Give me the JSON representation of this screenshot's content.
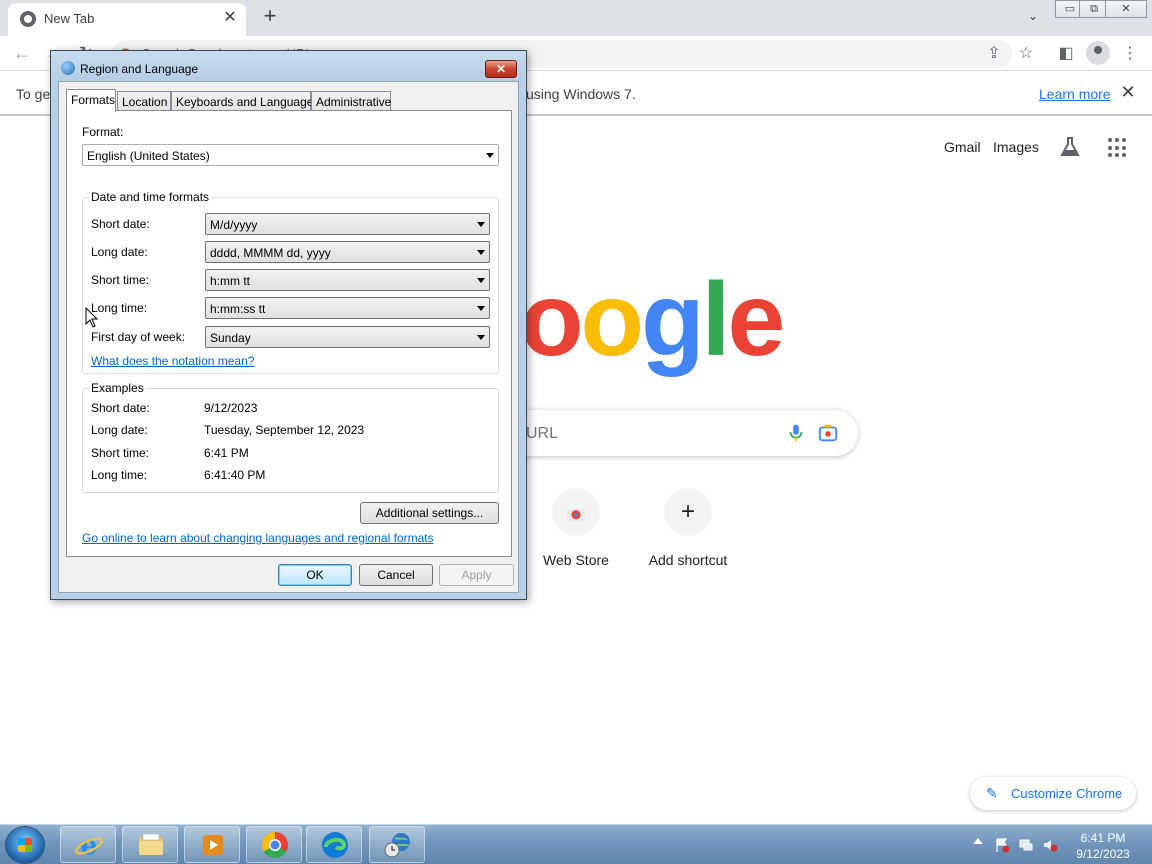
{
  "browser": {
    "tab_title": "New Tab",
    "omnibox_placeholder": "Search Google or type a URL",
    "infobar": {
      "message_start": "To get future Google Chrome updates, you'll need Windows 10 or later. This computer is using Windows 7.",
      "message_visible_left": "To get",
      "message_visible_right": "using Windows 7.",
      "learn_more": "Learn more"
    },
    "header_links": [
      "Gmail",
      "Images"
    ],
    "logo_letters": [
      "o",
      "o",
      "g",
      "l",
      "e"
    ],
    "logo_colors": [
      "#ea4335",
      "#fbbc05",
      "#4285f4",
      "#34a853",
      "#ea4335"
    ],
    "search_placeholder": "URL",
    "shortcuts": [
      {
        "label": "Web Store",
        "icon": "chrome-web-store-icon"
      },
      {
        "label": "Add shortcut",
        "icon": "plus-icon",
        "glyph": "+"
      }
    ],
    "customize_label": "Customize Chrome"
  },
  "dialog": {
    "title": "Region and Language",
    "tabs": [
      "Formats",
      "Location",
      "Keyboards and Languages",
      "Administrative"
    ],
    "active_tab": "Formats",
    "format_label": "Format:",
    "format_value": "English (United States)",
    "datetime_group_title": "Date and time formats",
    "datetime_rows": [
      {
        "label": "Short date:",
        "value": "M/d/yyyy"
      },
      {
        "label": "Long date:",
        "value": "dddd, MMMM dd, yyyy"
      },
      {
        "label": "Short time:",
        "value": "h:mm tt"
      },
      {
        "label": "Long time:",
        "value": "h:mm:ss tt"
      },
      {
        "label": "First day of week:",
        "value": "Sunday"
      }
    ],
    "notation_link": "What does the notation mean?",
    "examples_group_title": "Examples",
    "examples": [
      {
        "label": "Short date:",
        "value": "9/12/2023"
      },
      {
        "label": "Long date:",
        "value": "Tuesday, September 12, 2023"
      },
      {
        "label": "Short time:",
        "value": "6:41 PM"
      },
      {
        "label": "Long time:",
        "value": "6:41:40 PM"
      }
    ],
    "additional_settings": "Additional settings...",
    "online_link": "Go online to learn about changing languages and regional formats",
    "ok": "OK",
    "cancel": "Cancel",
    "apply": "Apply"
  },
  "taskbar": {
    "pinned": [
      "internet-explorer-icon",
      "file-explorer-icon",
      "media-player-icon",
      "chrome-icon",
      "edge-icon",
      "region-language-icon"
    ],
    "clock_time": "6:41 PM",
    "clock_date": "9/12/2023"
  }
}
